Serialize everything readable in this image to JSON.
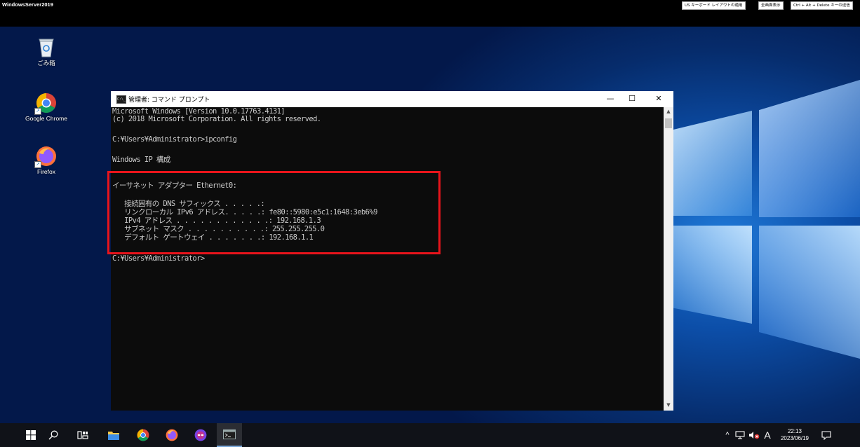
{
  "remote": {
    "title": "WindowsServer2019",
    "btn_keyboard": "US キーボード レイアウトの適用",
    "btn_fullscreen": "全画面表示",
    "btn_cad": "Ctrl + Alt + Delete キーの送信"
  },
  "desktop_icons": {
    "recycle": "ごみ箱",
    "chrome": "Google Chrome",
    "firefox": "Firefox"
  },
  "cmd": {
    "title": "管理者: コマンド プロンプト",
    "icon_text": "C:\\_",
    "minimize": "—",
    "maximize": "☐",
    "close": "✕",
    "lines": [
      "Microsoft Windows [Version 10.0.17763.4131]",
      "(c) 2018 Microsoft Corporation. All rights reserved.",
      "C:¥Users¥Administrator>ipconfig",
      "Windows IP 構成",
      "イーサネット アダプター Ethernet0:",
      "   接続固有の DNS サフィックス . . . . .:",
      "   リンクローカル IPv6 アドレス. . . . .: fe80::5980:e5c1:1648:3eb6%9",
      "   IPv4 アドレス . . . . . . . . . . . .: 192.168.1.3",
      "   サブネット マスク . . . . . . . . . .: 255.255.255.0",
      "   デフォルト ゲートウェイ . . . . . . .: 192.168.1.1",
      "C:¥Users¥Administrator>"
    ]
  },
  "taskbar": {
    "tray_chevron": "^",
    "ime": "A",
    "time": "22:13",
    "date": "2023/06/19"
  },
  "colors": {
    "highlight": "#e8141b",
    "cmd_bg": "#0c0c0c",
    "cmd_text": "#cccccc",
    "taskbar": "#101218"
  }
}
